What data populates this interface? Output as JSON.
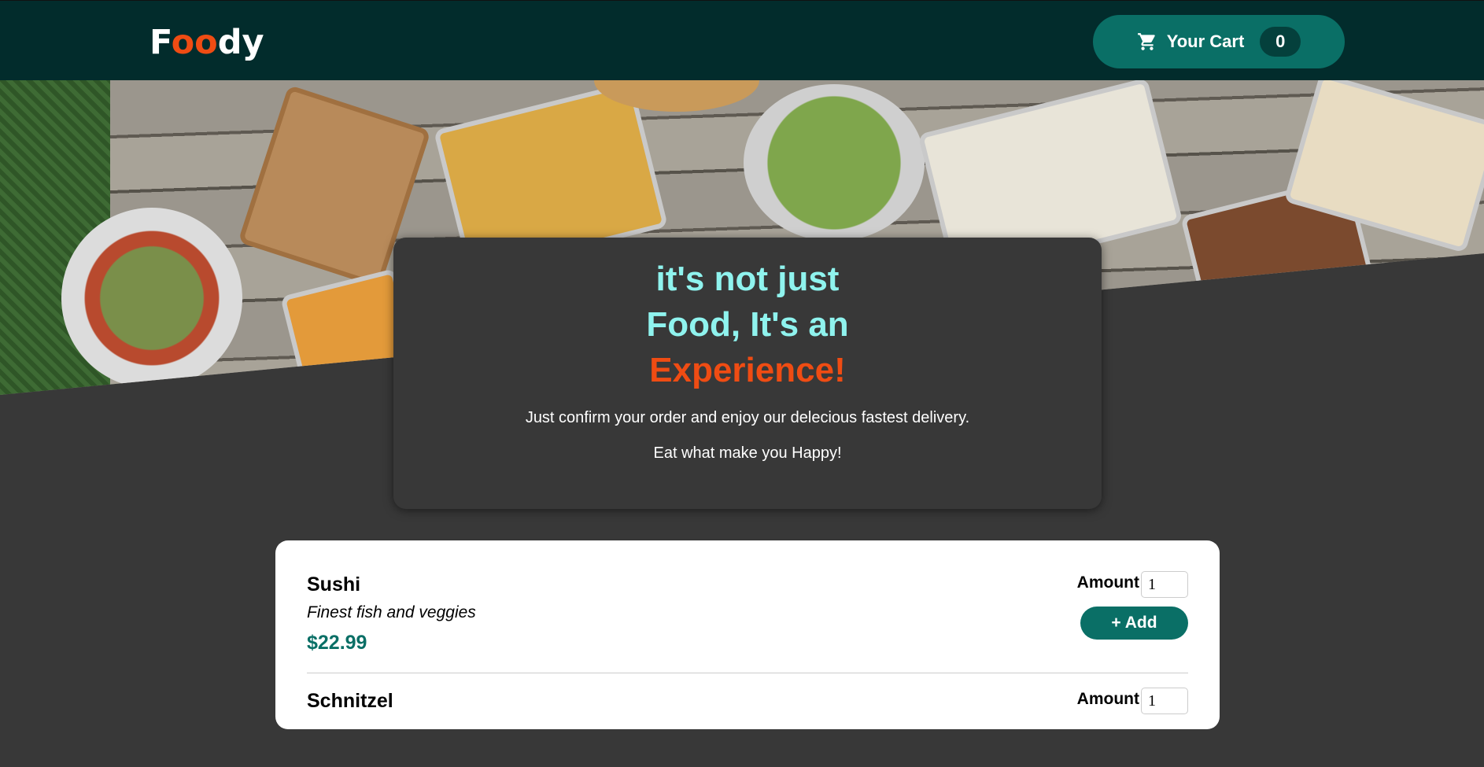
{
  "header": {
    "logo_f": "F",
    "logo_oo": "oo",
    "logo_dy": "dy",
    "cart_label": "Your Cart",
    "cart_count": "0",
    "colors": {
      "bar": "#022c2c",
      "accent": "#ef4c13",
      "button": "#0a6f66"
    }
  },
  "hero": {
    "headline_line1": "it's not just",
    "headline_line2": "Food, It's an",
    "headline_line3": "Experience!",
    "text1": "Just confirm your order and enjoy our delecious fastest delivery.",
    "text2": "Eat what make you Happy!"
  },
  "meals": [
    {
      "name": "Sushi",
      "description": "Finest fish and veggies",
      "price": "$22.99",
      "amount_label": "Amount",
      "amount_value": "1",
      "add_label": "+ Add"
    },
    {
      "name": "Schnitzel",
      "description": "",
      "price": "",
      "amount_label": "Amount",
      "amount_value": "1",
      "add_label": ""
    }
  ]
}
